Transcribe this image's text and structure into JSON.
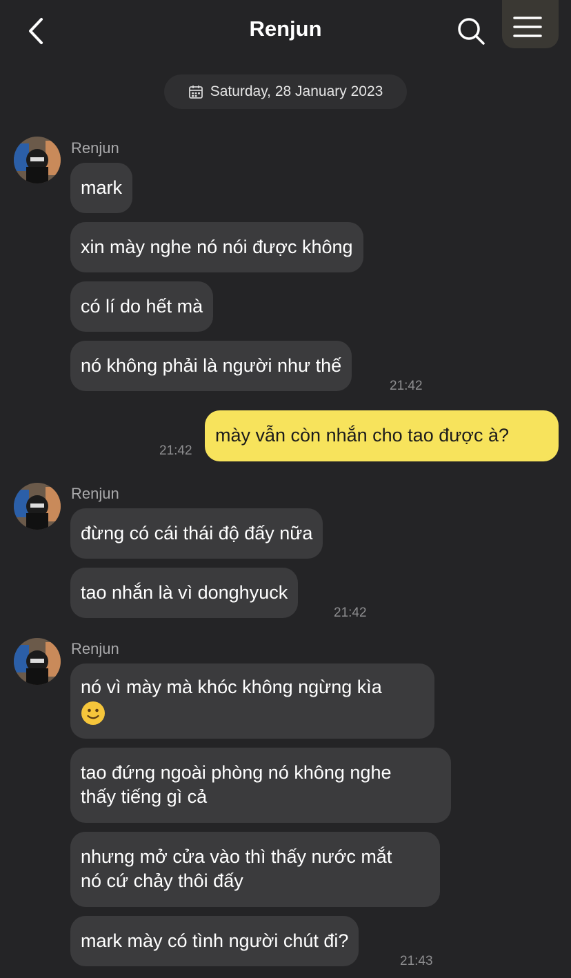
{
  "header": {
    "title": "Renjun"
  },
  "date_separator": "Saturday, 28 January 2023",
  "groups": [
    {
      "sender": "Renjun",
      "messages": [
        "mark",
        "xin mày nghe nó nói được không",
        "có lí do hết mà",
        "nó không phải là người như thế"
      ],
      "time": "21:42"
    },
    {
      "me": true,
      "messages": [
        "mày vẫn còn nhắn cho tao được à?"
      ],
      "time": "21:42"
    },
    {
      "sender": "Renjun",
      "messages": [
        "đừng có cái thái độ đấy nữa",
        "tao nhắn là vì donghyuck"
      ],
      "time": "21:42"
    },
    {
      "sender": "Renjun",
      "messages": [
        "nó vì mày mà khóc không ngừng kìa",
        "tao đứng ngoài phòng nó không nghe",
        "thấy tiếng gì cả",
        "nhưng mở cửa vào thì thấy nước mắt",
        "nó cứ chảy thôi đấy",
        "mark mày có tình người chút đi?"
      ],
      "time": "21:43"
    }
  ],
  "icons": {
    "back": "chevron-left-icon",
    "search": "search-icon",
    "menu": "menu-icon",
    "calendar": "calendar-icon",
    "emoji": "slightly-smiling-face-emoji"
  },
  "colors": {
    "background": "#242426",
    "incoming_bubble": "#3b3b3d",
    "outgoing_bubble": "#f7e35c"
  }
}
